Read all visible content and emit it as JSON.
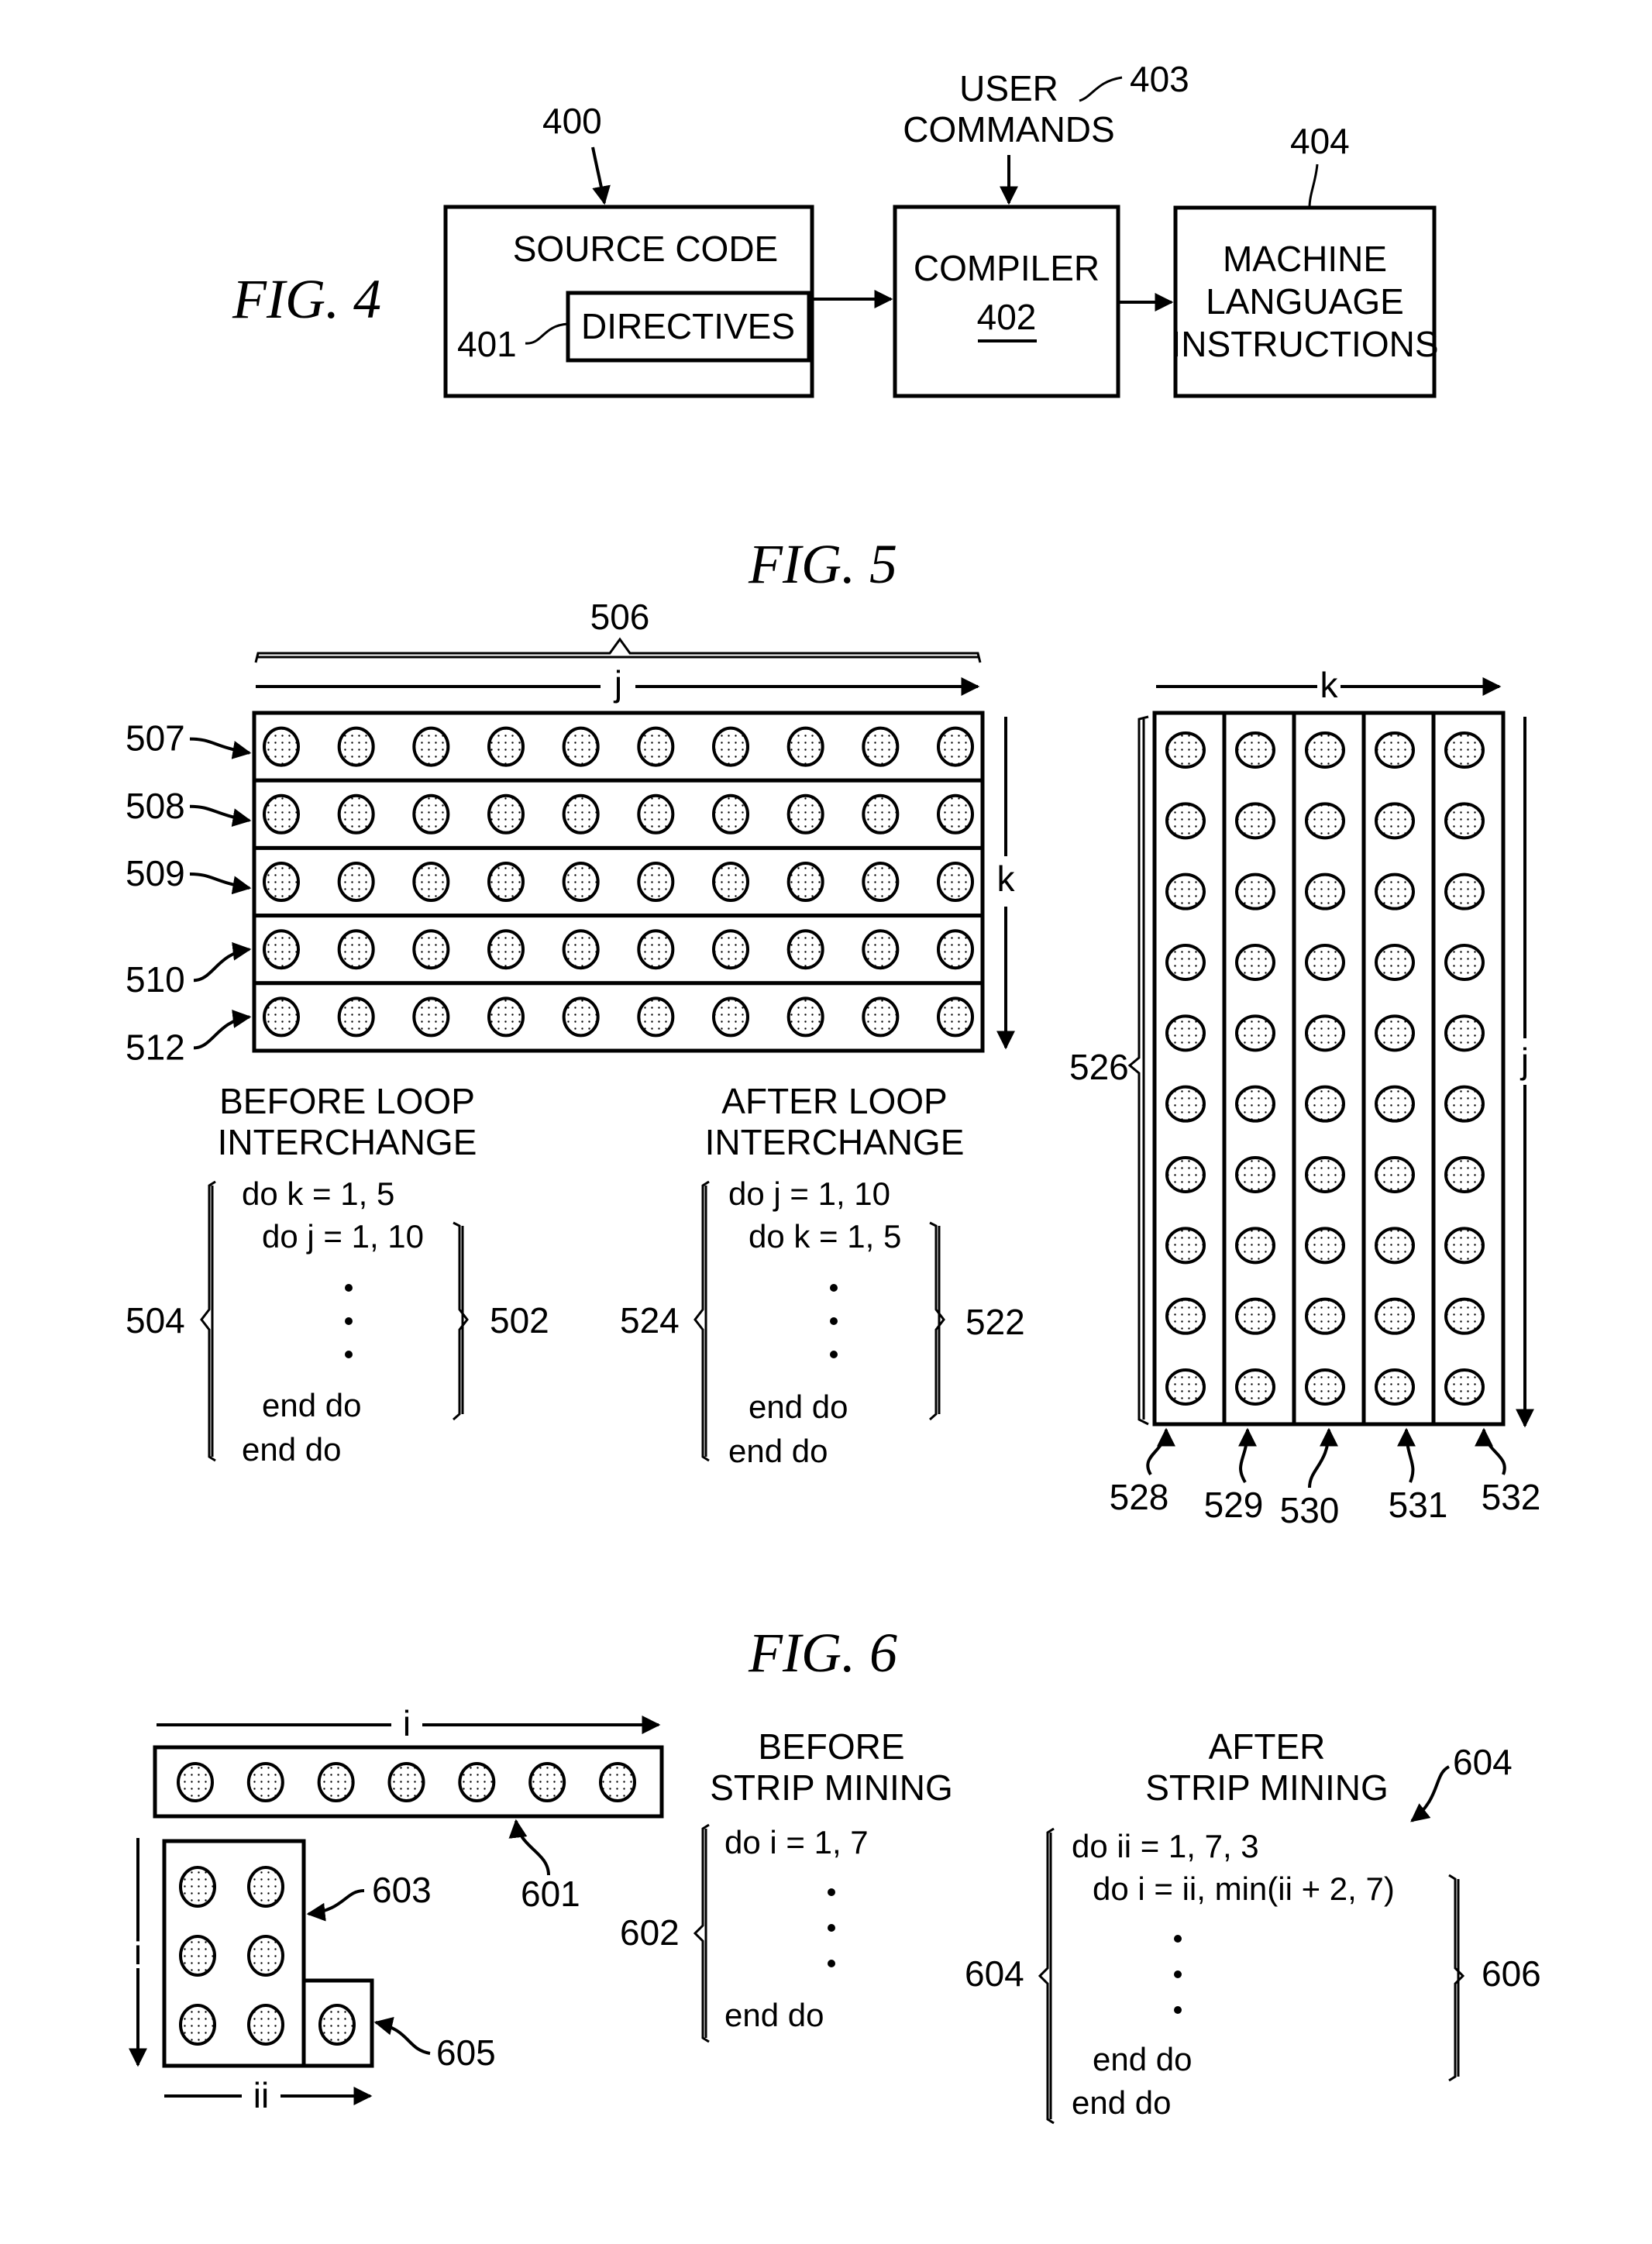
{
  "fig4": {
    "title": "FIG. 4",
    "source_ref": "400",
    "source_label": "SOURCE CODE",
    "directives_label": "DIRECTIVES",
    "directives_ref": "401",
    "user_commands_line1": "USER",
    "user_commands_line2": "COMMANDS",
    "user_commands_ref": "403",
    "compiler_label": "COMPILER",
    "compiler_ref": "402",
    "machine_line1": "MACHINE",
    "machine_line2": "LANGUAGE",
    "machine_line3": "INSTRUCTIONS",
    "machine_ref": "404"
  },
  "fig5": {
    "title": "FIG. 5",
    "left_grid": {
      "brace_ref": "506",
      "horizontal_axis": "j",
      "vertical_axis": "k",
      "rows": 5,
      "cols": 10,
      "row_refs": [
        "507",
        "508",
        "509",
        "510",
        "512"
      ]
    },
    "right_grid": {
      "horizontal_axis": "k",
      "vertical_axis": "j",
      "rows": 10,
      "cols": 5,
      "brace_ref": "526",
      "col_refs": [
        "528",
        "529",
        "530",
        "531",
        "532"
      ]
    },
    "before": {
      "heading_line1": "BEFORE LOOP",
      "heading_line2": "INTERCHANGE",
      "outer_ref": "504",
      "inner_ref": "502",
      "lines": [
        "do k = 1, 5",
        "do j = 1, 10",
        "end do",
        "end do"
      ]
    },
    "after": {
      "heading_line1": "AFTER LOOP",
      "heading_line2": "INTERCHANGE",
      "outer_ref": "524",
      "inner_ref": "522",
      "lines": [
        "do j = 1, 10",
        "do k = 1, 5",
        "end do",
        "end do"
      ]
    }
  },
  "fig6": {
    "title": "FIG. 6",
    "strip": {
      "axis": "i",
      "count": 7,
      "ref": "601"
    },
    "blocks": {
      "vertical_axis": "i",
      "horizontal_axis": "ii",
      "full_block_ref": "603",
      "full_rows": 3,
      "full_cols": 2,
      "remainder_ref": "605",
      "remainder_count": 1
    },
    "before": {
      "heading_line1": "BEFORE",
      "heading_line2": "STRIP MINING",
      "ref": "602",
      "lines": [
        "do i = 1, 7",
        "end do"
      ]
    },
    "after": {
      "heading_line1": "AFTER",
      "heading_line2": "STRIP MINING",
      "pointer_ref": "604",
      "outer_ref": "604",
      "inner_ref": "606",
      "lines": [
        "do ii = 1, 7, 3",
        "do i = ii, min(ii + 2, 7)",
        "end do",
        "end do"
      ]
    }
  }
}
